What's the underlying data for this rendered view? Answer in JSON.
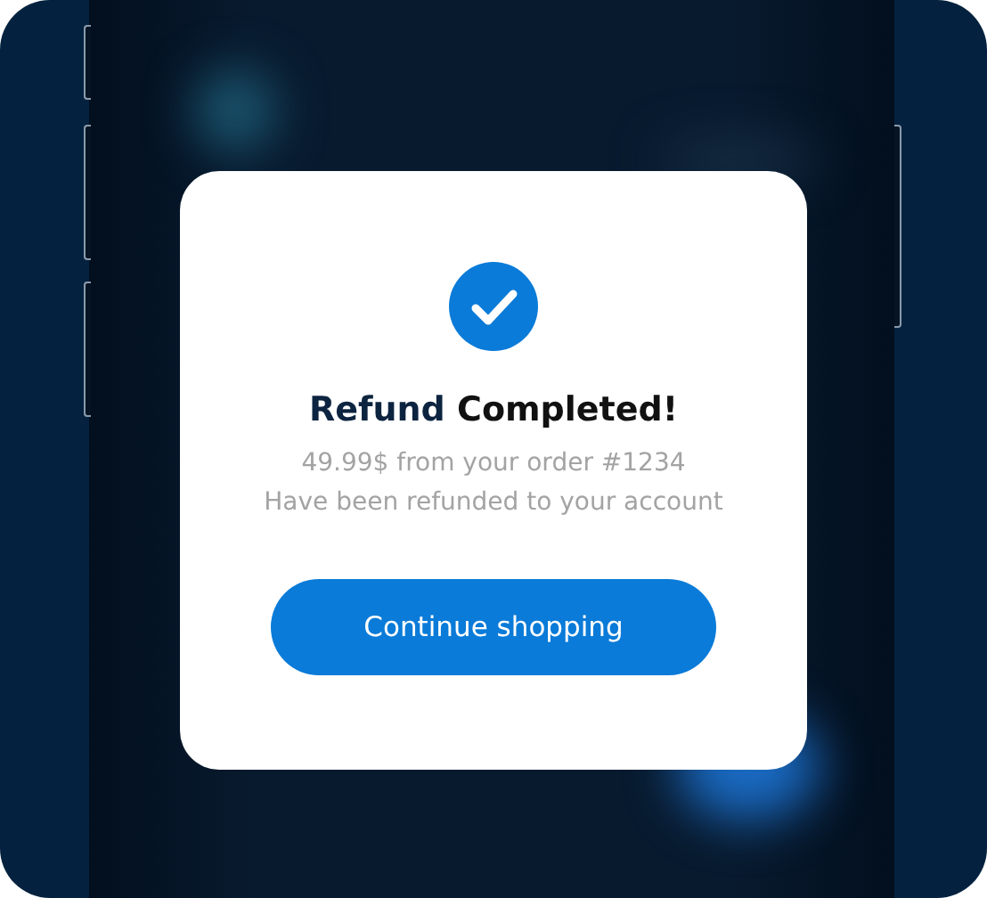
{
  "dialog": {
    "title_lead": "Refund",
    "title_rest": "Completed!",
    "lines": [
      "49.99$ from your order #1234",
      "Have been refunded to your account"
    ],
    "button": "Continue shopping"
  }
}
